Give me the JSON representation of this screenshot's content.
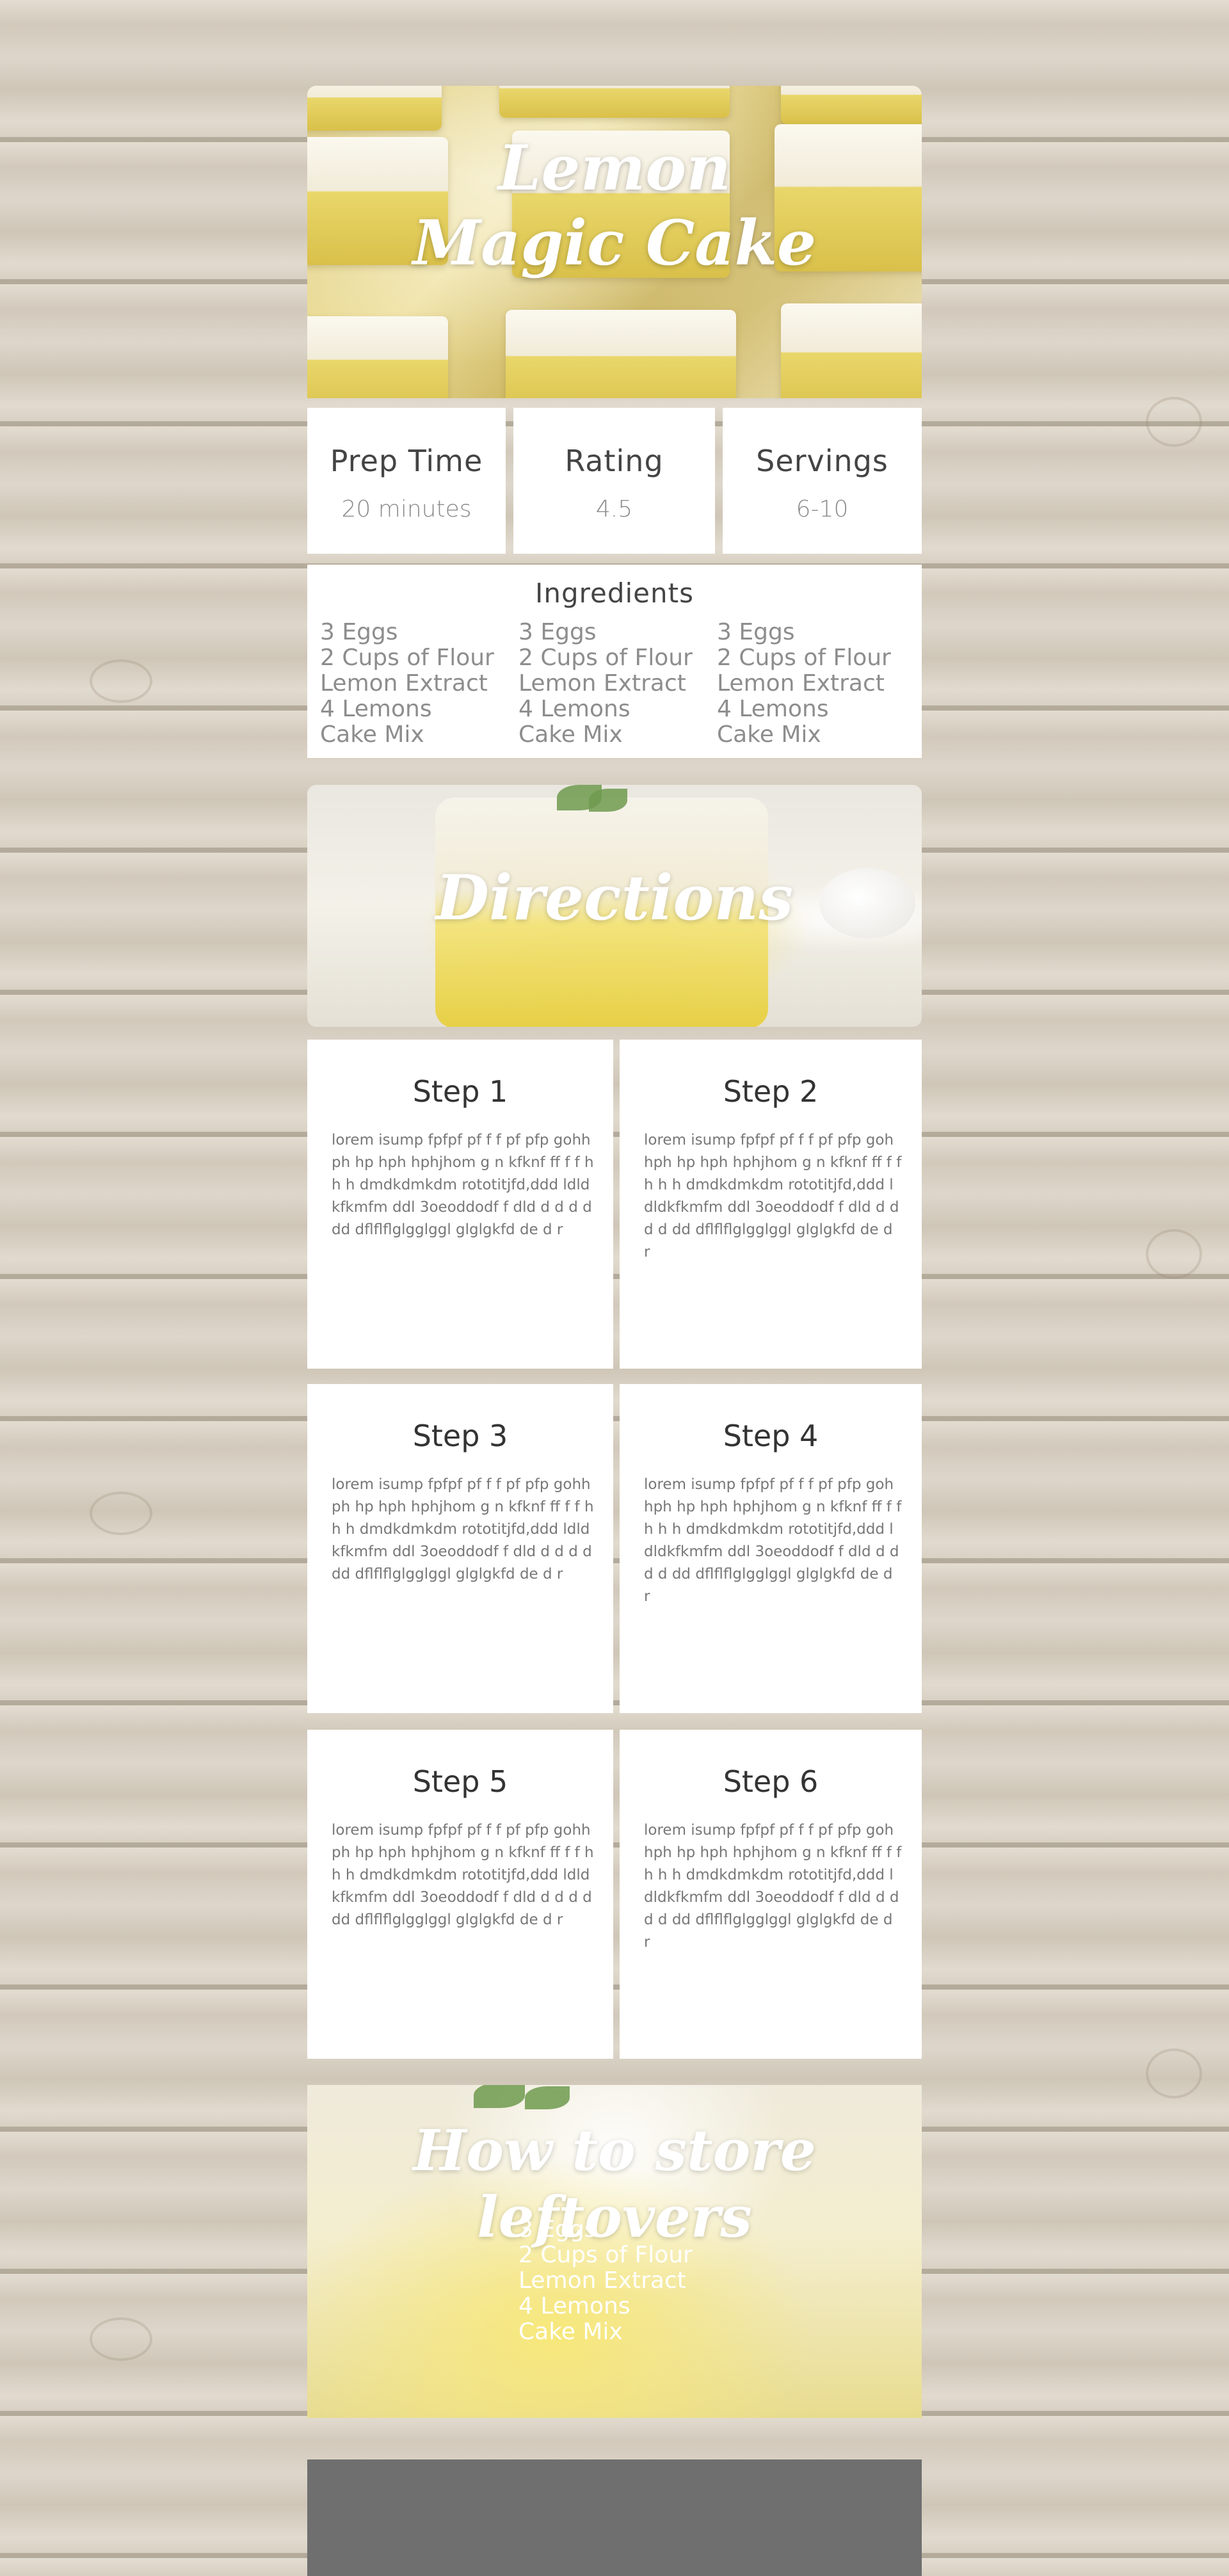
{
  "recipe": {
    "title": "Lemon Magic Cake"
  },
  "stats": [
    {
      "label": "Prep Time",
      "value": "20 minutes"
    },
    {
      "label": "Rating",
      "value": "4.5"
    },
    {
      "label": "Servings",
      "value": "6-10"
    }
  ],
  "ingredients": {
    "title": "Ingredients",
    "columns": [
      [
        "3 Eggs",
        "2 Cups of Flour",
        "Lemon Extract",
        "4 Lemons",
        "Cake Mix"
      ],
      [
        "3 Eggs",
        "2 Cups of Flour",
        "Lemon Extract",
        "4 Lemons",
        "Cake Mix"
      ],
      [
        "3 Eggs",
        "2 Cups of Flour",
        "Lemon Extract",
        "4 Lemons",
        "Cake Mix"
      ]
    ]
  },
  "directions": {
    "title": "Directions",
    "steps": [
      {
        "title": "Step 1",
        "body": "lorem isump fpfpf pf f f pf pfp gohhph hp hph hphjhom g n kfknf ff f f h h h dmdkdmkdm rototitjfd,ddd ldldkfkmfm ddl 3oeoddodf f dld d d d d dd dflflflglgglggl glglgkfd de d r"
      },
      {
        "title": "Step 2",
        "body": "lorem isump fpfpf pf f f pf pfp gohhph hp hph hphjhom g n kfknf ff f f h h h dmdkdmkdm rototitjfd,ddd ldldkfkmfm ddl 3oeoddodf f dld d d d d dd dflflflglgglggl glglgkfd de d r"
      },
      {
        "title": "Step 3",
        "body": "lorem isump fpfpf pf f f pf pfp gohhph hp hph hphjhom g n kfknf ff f f h h h dmdkdmkdm rototitjfd,ddd ldldkfkmfm ddl 3oeoddodf f dld d d d d dd dflflflglgglggl glglgkfd de d r"
      },
      {
        "title": "Step 4",
        "body": "lorem isump fpfpf pf f f pf pfp gohhph hp hph hphjhom g n kfknf ff f f h h h dmdkdmkdm rototitjfd,ddd ldldkfkmfm ddl 3oeoddodf f dld d d d d dd dflflflglgglggl glglgkfd de d r"
      },
      {
        "title": "Step 5",
        "body": "lorem isump fpfpf pf f f pf pfp gohhph hp hph hphjhom g n kfknf ff f f h h h dmdkdmkdm rototitjfd,ddd ldldkfkmfm ddl 3oeoddodf f dld d d d d dd dflflflglgglggl glglgkfd de d r"
      },
      {
        "title": "Step 6",
        "body": "lorem isump fpfpf pf f f pf pfp gohhph hp hph hphjhom g n kfknf ff f f h h h dmdkdmkdm rototitjfd,ddd ldldkfkmfm ddl 3oeoddodf f dld d d d d dd dflflflglgglggl glglgkfd de d r"
      }
    ]
  },
  "leftovers": {
    "title": "How to store leftovers",
    "items": [
      "3 Eggs",
      "2 Cups of Flour",
      "Lemon Extract",
      "4 Lemons",
      "Cake Mix"
    ]
  },
  "colors": {
    "card_background": "#ffffff",
    "footer": "#6f6f6f",
    "heading_text": "#444444",
    "muted_text": "#8d8d8d"
  }
}
